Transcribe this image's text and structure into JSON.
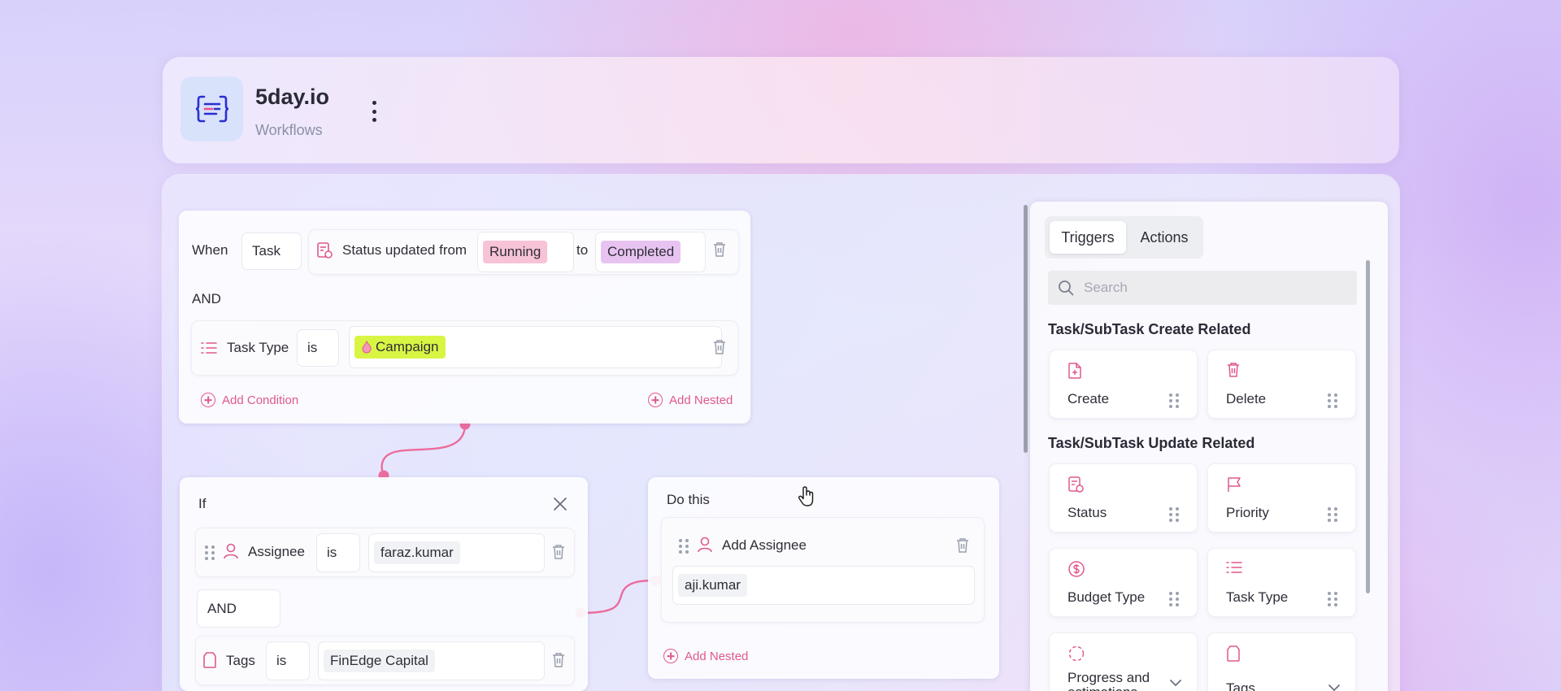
{
  "header": {
    "app_name": "5day.io",
    "section": "Workflows"
  },
  "trigger_card": {
    "when_label": "When",
    "entity": "Task",
    "event_text": "Status updated from",
    "from_value": "Running",
    "to_label": "to",
    "to_value": "Completed",
    "and_label": "AND",
    "condition": {
      "field": "Task Type",
      "operator": "is",
      "value": "Campaign"
    },
    "add_condition": "Add Condition",
    "add_nested": "Add Nested"
  },
  "if_card": {
    "title": "If",
    "rows": [
      {
        "field": "Assignee",
        "operator": "is",
        "value": "faraz.kumar"
      },
      {
        "field": "Tags",
        "operator": "is",
        "value": "FinEdge Capital"
      }
    ],
    "and_label": "AND"
  },
  "do_card": {
    "title": "Do this",
    "action": "Add Assignee",
    "value": "aji.kumar",
    "add_nested": "Add Nested"
  },
  "panel": {
    "tabs": [
      "Triggers",
      "Actions"
    ],
    "active_tab": "Triggers",
    "search_placeholder": "Search",
    "sections": [
      {
        "title": "Task/SubTask Create Related",
        "items": [
          "Create",
          "Delete"
        ]
      },
      {
        "title": "Task/SubTask Update Related",
        "items": [
          "Status",
          "Priority",
          "Budget Type",
          "Task Type",
          "Progress and estimations",
          "Tags"
        ]
      }
    ]
  },
  "colors": {
    "accent_pink": "#e0588f",
    "running_chip": "#f7c3d6",
    "completed_chip": "#e8c3f1",
    "campaign_chip": "#d9f543",
    "logo_bg": "#d9e2fb"
  },
  "icons": [
    "logo-icon",
    "kebab-menu-icon",
    "status-doc-icon",
    "trash-icon",
    "list-icon",
    "flame-icon",
    "plus-circle-icon",
    "close-icon",
    "drag-handle-icon",
    "user-icon",
    "tag-icon",
    "search-icon",
    "file-plus-icon",
    "flag-icon",
    "dollar-icon",
    "progress-icon",
    "chevron-down-icon",
    "hand-cursor-icon"
  ]
}
